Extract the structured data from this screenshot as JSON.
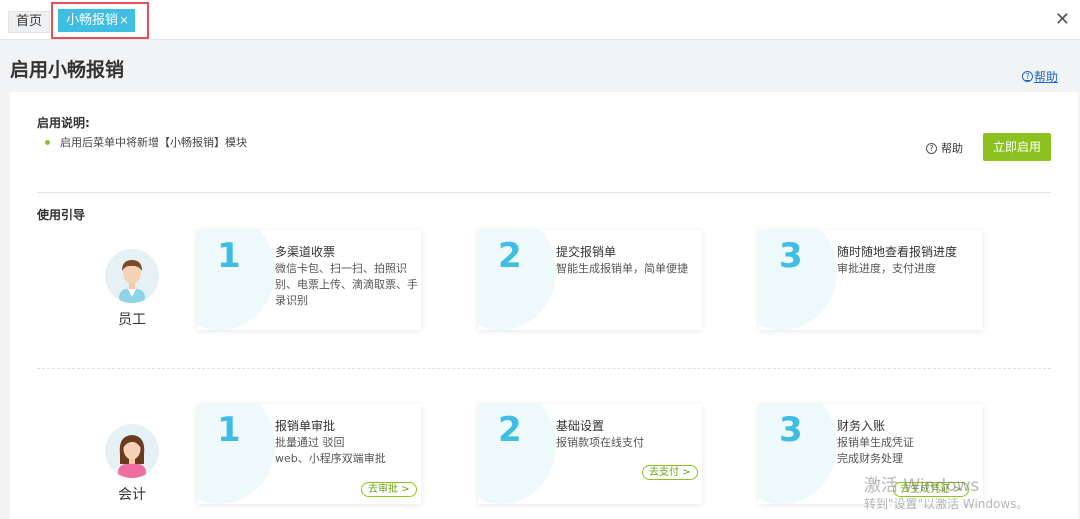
{
  "tabs": {
    "home": "首页",
    "active": "小畅报销",
    "close_symbol": "×"
  },
  "window_close": "✕",
  "page": {
    "title": "启用小畅报销",
    "help_link": "帮助"
  },
  "intro": {
    "title": "启用说明:",
    "items": [
      "启用后菜单中将新增【小畅报销】模块"
    ],
    "help_label": "帮助",
    "enable_button": "立即启用"
  },
  "guide": {
    "title": "使用引导",
    "roles": [
      {
        "label": "员工",
        "steps": [
          {
            "number": "1",
            "title": "多渠道收票",
            "desc": "微信卡包、扫一扫、拍照识别、电票上传、滴滴取票、手录识别"
          },
          {
            "number": "2",
            "title": "提交报销单",
            "desc": "智能生成报销单，简单便捷"
          },
          {
            "number": "3",
            "title": "随时随地查看报销进度",
            "desc": "审批进度，支付进度"
          }
        ]
      },
      {
        "label": "会计",
        "steps": [
          {
            "number": "1",
            "title": "报销单审批",
            "desc_lines": [
              "批量通过 驳回",
              "web、小程序双端审批"
            ],
            "action": "去审批 >"
          },
          {
            "number": "2",
            "title": "基础设置",
            "desc": "报销款项在线支付",
            "action": "去支付 >"
          },
          {
            "number": "3",
            "title": "财务入账",
            "desc_lines": [
              "报销单生成凭证",
              "完成财务处理"
            ],
            "action": "去生成凭证 >"
          }
        ]
      }
    ]
  },
  "watermark": {
    "line1": "激活 Windows",
    "line2": "转到\"设置\"以激活 Windows。"
  },
  "colors": {
    "accent": "#3fbde3",
    "green": "#8cc21f",
    "highlight_outline": "#e6505a",
    "link": "#1a66c8"
  }
}
